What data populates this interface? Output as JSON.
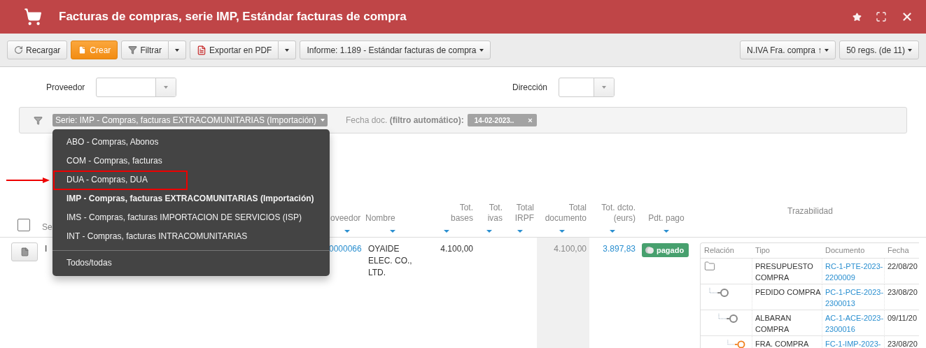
{
  "window": {
    "title": "Facturas de compras, serie IMP, Estándar facturas de compra"
  },
  "toolbar": {
    "left": [
      {
        "kind": "reload",
        "label": "Recargar"
      },
      {
        "kind": "create",
        "label": "Crear"
      },
      {
        "kind": "filter",
        "label": "Filtrar"
      },
      {
        "kind": "export",
        "label": "Exportar en PDF"
      },
      {
        "kind": "report",
        "label": "Informe: 1.189 - Estándar facturas de compra"
      }
    ],
    "right": [
      {
        "label": "N.IVA Fra. compra ↑"
      },
      {
        "label": "50 regs. (de 11)"
      }
    ]
  },
  "fields": [
    {
      "label": "Proveedor"
    },
    {
      "label": "Dirección"
    }
  ],
  "filter_bar": {
    "serie_chip": "Serie: IMP - Compras, facturas EXTRACOMUNITARIAS (Importación)",
    "date_label": "Fecha doc. **(filtro automático):**",
    "date_chip": "14-02-2023..",
    "date_remove": "×"
  },
  "menu": {
    "items": [
      {
        "label": "ABO - Compras, Abonos",
        "selected": false,
        "highlighted": false
      },
      {
        "label": "COM - Compras, facturas",
        "selected": false,
        "highlighted": false
      },
      {
        "label": "DUA - Compras, DUA",
        "selected": false,
        "highlighted": true
      },
      {
        "label": "IMP - Compras, facturas EXTRACOMUNITARIAS (Importación)",
        "selected": true,
        "highlighted": false
      },
      {
        "label": "IMS - Compras, facturas IMPORTACION DE SERVICIOS (ISP)",
        "selected": false,
        "highlighted": false
      },
      {
        "label": "INT - Compras, facturas INTRACOMUNITARIAS",
        "selected": false,
        "highlighted": false
      }
    ],
    "footer": "Todos/todas"
  },
  "table": {
    "select_all_checked": false,
    "columns": [
      {
        "label": "Se",
        "kind": "text",
        "sortable": false
      },
      {
        "label": "oveedor",
        "kind": "text",
        "sortable": true
      },
      {
        "label": "Nombre",
        "kind": "text",
        "sortable": true
      },
      {
        "label": "Tot.\nbases",
        "kind": "number",
        "sortable": true
      },
      {
        "label": "Tot.\nivas",
        "kind": "number",
        "sortable": true
      },
      {
        "label": "Total\nIRPF",
        "kind": "number",
        "sortable": true
      },
      {
        "label": "Total\ndocumento",
        "kind": "number",
        "sortable": true
      },
      {
        "label": "Tot. dcto.\n(eurs)",
        "kind": "number",
        "sortable": true
      },
      {
        "label": "Pdt. pago",
        "kind": "status",
        "sortable": true
      },
      {
        "label": "Trazabilidad",
        "kind": "trace",
        "sortable": false
      }
    ],
    "rows": [
      {
        "serie": "I",
        "proveedor": "0000066",
        "nombre": "OYAIDE ELEC. CO., LTD.",
        "tot_bases": "4.100,00",
        "total_documento": "4.100,00",
        "tot_dcto": "3.897,83",
        "pdt_pago": "pagado",
        "trace": {
          "columns": [
            "Relación",
            "Tipo",
            "Documento",
            "Fecha"
          ],
          "rows": [
            {
              "tipo": "PRESUPUESTO COMPRA",
              "documento": "RC-1-PTE-2023-2200009",
              "fecha": "22/08/20",
              "current": false,
              "children": [
                {
                  "tipo": "PEDIDO COMPRA",
                  "documento": "PC-1-PCE-2023-2300013",
                  "fecha": "23/08/20",
                  "current": false,
                  "children": [
                    {
                      "tipo": "ALBARAN COMPRA",
                      "documento": "AC-1-ACE-2023-2300016",
                      "fecha": "09/11/20",
                      "current": false,
                      "children": [
                        {
                          "tipo": "FRA. COMPRA",
                          "documento": "FC-1-IMP-2023-",
                          "fecha": "23/08/20",
                          "current": true
                        }
                      ]
                    }
                  ]
                }
              ]
            }
          ]
        }
      }
    ]
  }
}
